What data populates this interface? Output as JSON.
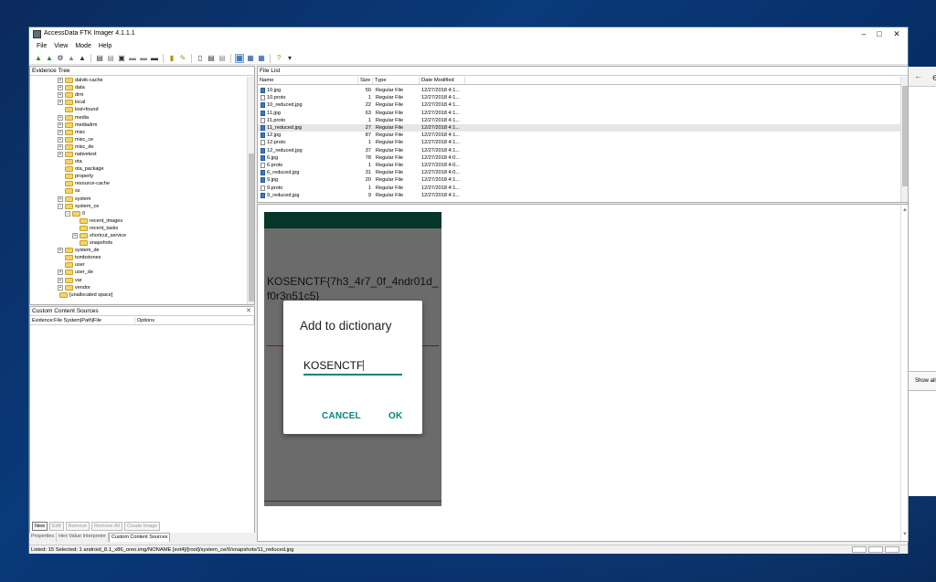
{
  "window": {
    "title": "AccessData FTK Imager 4.1.1.1"
  },
  "menu": [
    "File",
    "View",
    "Mode",
    "Help"
  ],
  "evidence_tree": {
    "title": "Evidence Tree",
    "items": [
      {
        "label": "dalvik-cache",
        "level": 0,
        "expander": "+"
      },
      {
        "label": "data",
        "level": 0,
        "expander": "+"
      },
      {
        "label": "drm",
        "level": 0,
        "expander": "+"
      },
      {
        "label": "local",
        "level": 0,
        "expander": "+"
      },
      {
        "label": "lost+found",
        "level": 0,
        "expander": ""
      },
      {
        "label": "media",
        "level": 0,
        "expander": "+"
      },
      {
        "label": "mediadrm",
        "level": 0,
        "expander": "+"
      },
      {
        "label": "misc",
        "level": 0,
        "expander": "+"
      },
      {
        "label": "misc_ce",
        "level": 0,
        "expander": "+"
      },
      {
        "label": "misc_de",
        "level": 0,
        "expander": "+"
      },
      {
        "label": "nativetest",
        "level": 0,
        "expander": "+"
      },
      {
        "label": "ota",
        "level": 0,
        "expander": ""
      },
      {
        "label": "ota_package",
        "level": 0,
        "expander": ""
      },
      {
        "label": "property",
        "level": 0,
        "expander": ""
      },
      {
        "label": "resource-cache",
        "level": 0,
        "expander": ""
      },
      {
        "label": "ss",
        "level": 0,
        "expander": ""
      },
      {
        "label": "system",
        "level": 0,
        "expander": "+"
      },
      {
        "label": "system_ce",
        "level": 0,
        "expander": "-"
      },
      {
        "label": "0",
        "level": 1,
        "expander": "-"
      },
      {
        "label": "recent_images",
        "level": 2,
        "expander": ""
      },
      {
        "label": "recent_tasks",
        "level": 2,
        "expander": ""
      },
      {
        "label": "shortcut_service",
        "level": 2,
        "expander": "+"
      },
      {
        "label": "snapshots",
        "level": 2,
        "expander": ""
      },
      {
        "label": "system_de",
        "level": 0,
        "expander": "+"
      },
      {
        "label": "tombstones",
        "level": 0,
        "expander": ""
      },
      {
        "label": "user",
        "level": 0,
        "expander": ""
      },
      {
        "label": "user_de",
        "level": 0,
        "expander": "+"
      },
      {
        "label": "var",
        "level": 0,
        "expander": "+"
      },
      {
        "label": "vendor",
        "level": 0,
        "expander": "+"
      },
      {
        "label": "[unallocated space]",
        "level": -1,
        "expander": ""
      }
    ]
  },
  "custom_content": {
    "title": "Custom Content Sources",
    "columns": [
      "Evidence:File System|Path|File",
      "Options"
    ],
    "buttons": [
      "New",
      "Edit",
      "Remove",
      "Remove All",
      "Create Image"
    ]
  },
  "tabs": [
    "Properties",
    "Hex Value Interpreter",
    "Custom Content Sources"
  ],
  "file_list": {
    "title": "File List",
    "columns": [
      "Name",
      "Size",
      "Type",
      "Date Modified"
    ],
    "rows": [
      {
        "name": "10.jpg",
        "size": "50",
        "type": "Regular File",
        "date": "12/27/2018 4:1...",
        "kind": "img",
        "selected": false
      },
      {
        "name": "10.proto",
        "size": "1",
        "type": "Regular File",
        "date": "12/27/2018 4:1...",
        "kind": "doc",
        "selected": false
      },
      {
        "name": "10_reduced.jpg",
        "size": "22",
        "type": "Regular File",
        "date": "12/27/2018 4:1...",
        "kind": "img",
        "selected": false
      },
      {
        "name": "11.jpg",
        "size": "63",
        "type": "Regular File",
        "date": "12/27/2018 4:1...",
        "kind": "img",
        "selected": false
      },
      {
        "name": "11.proto",
        "size": "1",
        "type": "Regular File",
        "date": "12/27/2018 4:1...",
        "kind": "doc",
        "selected": false
      },
      {
        "name": "11_reduced.jpg",
        "size": "27",
        "type": "Regular File",
        "date": "12/27/2018 4:1...",
        "kind": "img",
        "selected": true
      },
      {
        "name": "12.jpg",
        "size": "87",
        "type": "Regular File",
        "date": "12/27/2018 4:1...",
        "kind": "img",
        "selected": false
      },
      {
        "name": "12.proto",
        "size": "1",
        "type": "Regular File",
        "date": "12/27/2018 4:1...",
        "kind": "doc",
        "selected": false
      },
      {
        "name": "12_reduced.jpg",
        "size": "37",
        "type": "Regular File",
        "date": "12/27/2018 4:1...",
        "kind": "img",
        "selected": false
      },
      {
        "name": "6.jpg",
        "size": "78",
        "type": "Regular File",
        "date": "12/27/2018 4:0...",
        "kind": "img",
        "selected": false
      },
      {
        "name": "6.proto",
        "size": "1",
        "type": "Regular File",
        "date": "12/27/2018 4:0...",
        "kind": "doc",
        "selected": false
      },
      {
        "name": "6_reduced.jpg",
        "size": "31",
        "type": "Regular File",
        "date": "12/27/2018 4:0...",
        "kind": "img",
        "selected": false
      },
      {
        "name": "9.jpg",
        "size": "20",
        "type": "Regular File",
        "date": "12/27/2018 4:1...",
        "kind": "img",
        "selected": false
      },
      {
        "name": "9.proto",
        "size": "1",
        "type": "Regular File",
        "date": "12/27/2018 4:1...",
        "kind": "doc",
        "selected": false
      },
      {
        "name": "9_reduced.jpg",
        "size": "9",
        "type": "Regular File",
        "date": "12/27/2018 4:1...",
        "kind": "img",
        "selected": false
      }
    ]
  },
  "viewer": {
    "flag_text": "KOSENCTF{7h3_4r7_0f_4ndr01d_f0r3n51c5}",
    "dialog": {
      "title": "Add to dictionary",
      "input_value": "KOSENCTF",
      "cancel": "CANCEL",
      "ok": "OK"
    }
  },
  "status": {
    "text": "Listed: 15  Selected: 1  android_8.1_x86_oreo.img/NONAME [ext4]/[root]/system_ce/0/snapshots/11_reduced.jpg"
  },
  "bgwin": {
    "show_all": "Show all"
  }
}
